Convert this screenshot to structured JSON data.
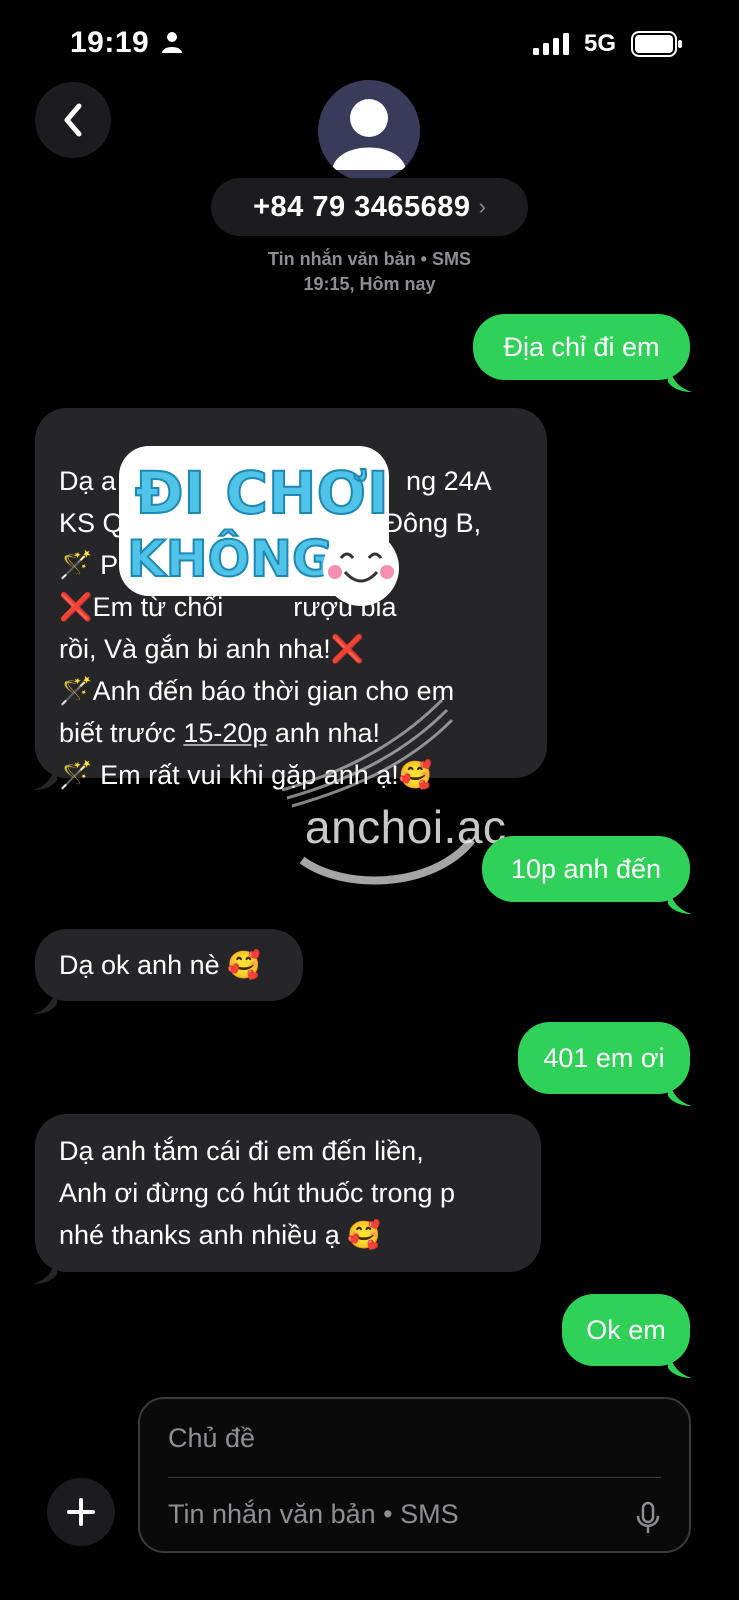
{
  "status_bar": {
    "time": "19:19",
    "network": "5G",
    "icons": [
      "person-icon",
      "signal-icon",
      "battery-icon"
    ]
  },
  "header": {
    "back_icon": "chevron-left-icon",
    "avatar_icon": "person-avatar-icon",
    "contact_number": "+84 79 3465689",
    "chevron": "›"
  },
  "thread_meta": {
    "line1": "Tin nhắn văn bản • SMS",
    "line2": "19:15, Hôm nay"
  },
  "messages": [
    {
      "direction": "outgoing",
      "lines": [
        "Địa chỉ đi em"
      ]
    },
    {
      "direction": "incoming",
      "lines": [
        "Dạ a",
        "ng 24A",
        "KS Q",
        "Đông B,",
        "🪄 P",
        "❌Em từ chối",
        "rượu bia",
        "rồi, Và gắn bi anh nha!❌",
        "🪄Anh đến báo thời gian cho em",
        "biết trước ",
        "15-20p",
        " anh nha!",
        "🪄 Em rất vui khi gặp anh ạ!🥰"
      ]
    },
    {
      "direction": "outgoing",
      "lines": [
        "10p anh đến"
      ]
    },
    {
      "direction": "incoming",
      "lines": [
        "Dạ ok anh nè 🥰"
      ]
    },
    {
      "direction": "outgoing",
      "lines": [
        "401 em ơi"
      ]
    },
    {
      "direction": "incoming",
      "lines": [
        "Dạ anh tắm cái đi em đến liền,",
        "Anh ơi đừng có hút thuốc trong p",
        "nhé thanks anh nhiều ạ 🥰"
      ]
    },
    {
      "direction": "outgoing",
      "lines": [
        "Ok em"
      ]
    }
  ],
  "overlays": {
    "sticker_line1": "ĐI CHƠI",
    "sticker_line2": "KHÔNG",
    "watermark": "anchoi.ac"
  },
  "compose": {
    "subject_placeholder": "Chủ đề",
    "message_placeholder": "Tin nhắn văn bản • SMS",
    "plus_icon": "plus-icon",
    "mic_icon": "microphone-icon"
  },
  "colors": {
    "outgoing_bubble": "#30d158",
    "incoming_bubble": "#262628",
    "background": "#000000",
    "meta_text": "#8e8e93"
  }
}
